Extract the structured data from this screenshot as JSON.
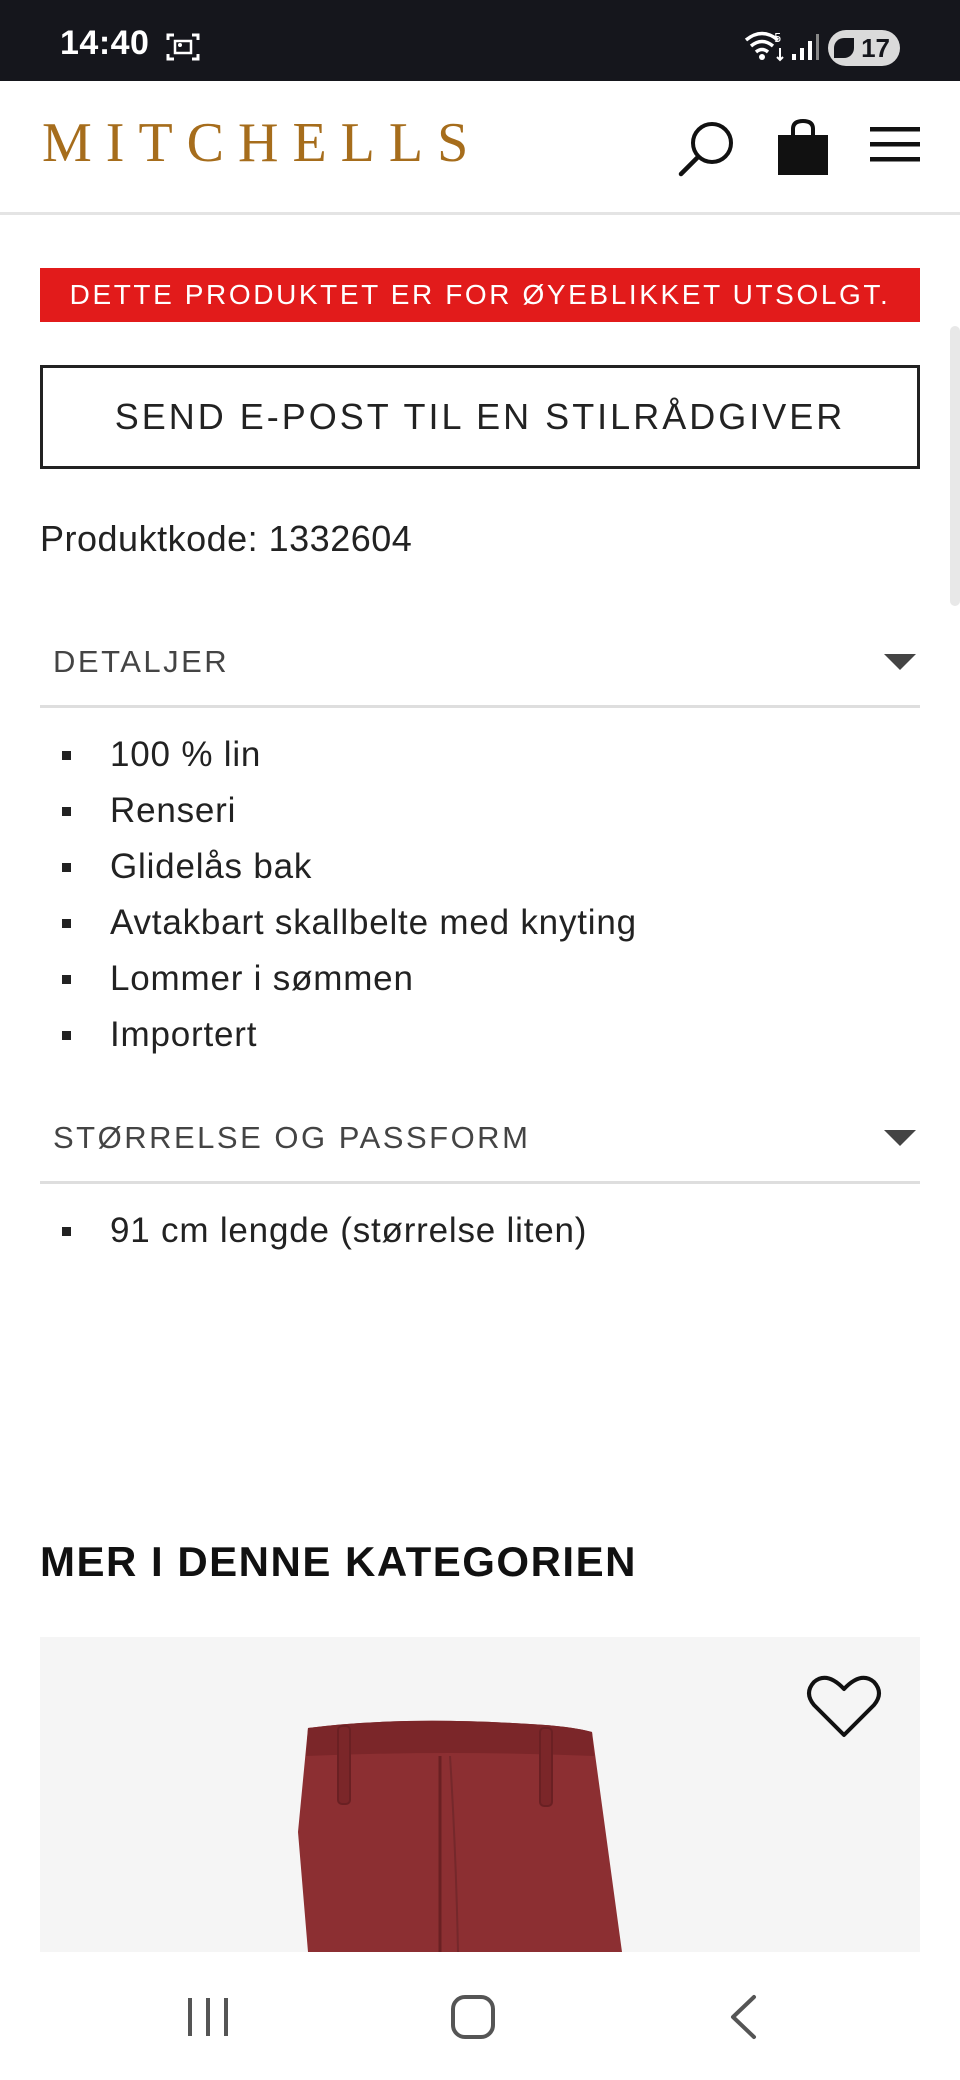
{
  "status_bar": {
    "time": "14:40",
    "battery": "17",
    "icons": [
      "screenshot-icon",
      "wifi-icon",
      "signal-icon",
      "battery-icon"
    ]
  },
  "header": {
    "logo": "MITCHELLS",
    "logo_color": "#a66d1c",
    "icons": [
      "search-icon",
      "shopping-bag-icon",
      "hamburger-menu-icon"
    ]
  },
  "product": {
    "sold_out_notice": "DETTE PRODUKTET ER FOR ØYEBLIKKET UTSOLGT.",
    "sold_out_color": "#e21b1b",
    "email_stylist_button": "SEND E-POST TIL EN STILRÅDGIVER",
    "product_code": "Produktkode: 1332604"
  },
  "sections": {
    "details": {
      "title": "DETALJER",
      "items": [
        "100 % lin",
        "Renseri",
        "Glidelås bak",
        "Avtakbart skallbelte med knyting",
        "Lommer i sømmen",
        "Importert"
      ]
    },
    "size_fit": {
      "title": "STØRRELSE OG PASSFORM",
      "items": [
        "91 cm lengde (størrelse liten)"
      ]
    }
  },
  "related": {
    "heading": "MER I DENNE KATEGORIEN",
    "product_color": "#8c2f32"
  },
  "nav_bar": {
    "icons": [
      "recent-apps-icon",
      "home-icon",
      "back-icon"
    ]
  }
}
